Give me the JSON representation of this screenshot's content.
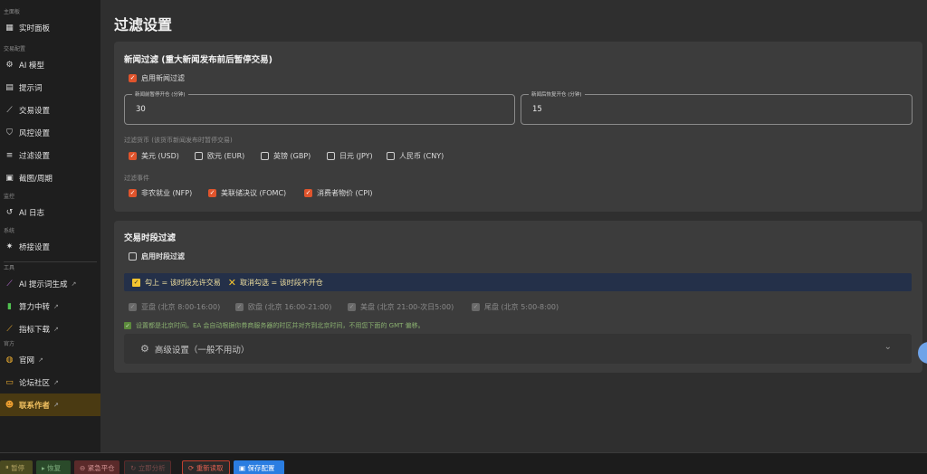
{
  "sidebar": {
    "sections": {
      "main": "主面板",
      "trade_config": "交易配置",
      "monitor": "监控",
      "system": "系统",
      "tools": "工具",
      "official": "官方"
    },
    "items": {
      "dashboard": "实时面板",
      "ai_model": "AI 模型",
      "prompt": "提示词",
      "trade_settings": "交易设置",
      "risk_settings": "风控设置",
      "filter_settings": "过滤设置",
      "screenshot": "截图/周期",
      "ai_log": "AI 日志",
      "bridge_settings": "桥接设置",
      "ai_prompt_gen": "AI 提示词生成",
      "compute_relay": "算力中转",
      "indicator_download": "指标下载",
      "website": "官网",
      "forum": "论坛社区",
      "contact_author": "联系作者"
    }
  },
  "page": {
    "title": "过滤设置"
  },
  "news_filter": {
    "title": "新闻过滤 (重大新闻发布前后暂停交易)",
    "enable_label": "启用新闻过滤",
    "before_label": "新闻前暂停开仓 (分钟)",
    "before_value": "30",
    "after_label": "新闻后恢复开仓 (分钟)",
    "after_value": "15",
    "currencies_label": "过滤货币 (该货币新闻发布时暂停交易)",
    "currencies": [
      "美元 (USD)",
      "欧元 (EUR)",
      "英镑 (GBP)",
      "日元 (JPY)",
      "人民币 (CNY)"
    ],
    "currencies_checked": [
      true,
      false,
      false,
      false,
      false
    ],
    "events_label": "过滤事件",
    "events": [
      "非农就业 (NFP)",
      "美联储决议 (FOMC)",
      "消费者物价 (CPI)"
    ],
    "events_checked": [
      true,
      true,
      true
    ]
  },
  "session_filter": {
    "title": "交易时段过滤",
    "enable_label": "启用时段过滤",
    "info_check": "勾上 = 该时段允许交易",
    "info_uncheck": "取消勾选 = 该时段不开仓",
    "sessions": [
      "亚盘 (北京 8:00-16:00)",
      "欧盘 (北京 16:00-21:00)",
      "美盘 (北京 21:00-次日5:00)",
      "尾盘 (北京 5:00-8:00)"
    ],
    "note": "设置都是北京时间。EA 会自动根据你券商服务器的时区并对齐到北京时间，不用您下面的 GMT 偏移。",
    "advanced_label": "高级设置（一般不用动）"
  },
  "bottom_bar": {
    "pause": "暂停",
    "resume": "恢复",
    "emergency_close": "紧急平仓",
    "analyze_now": "立即分析",
    "refresh_data": "重新读取",
    "save_config": "保存配置"
  },
  "colors": {
    "accent": "#e0542c",
    "info_bg": "#243049",
    "active_nav_bg": "#4a3a12",
    "save_button": "#2a7de1"
  }
}
